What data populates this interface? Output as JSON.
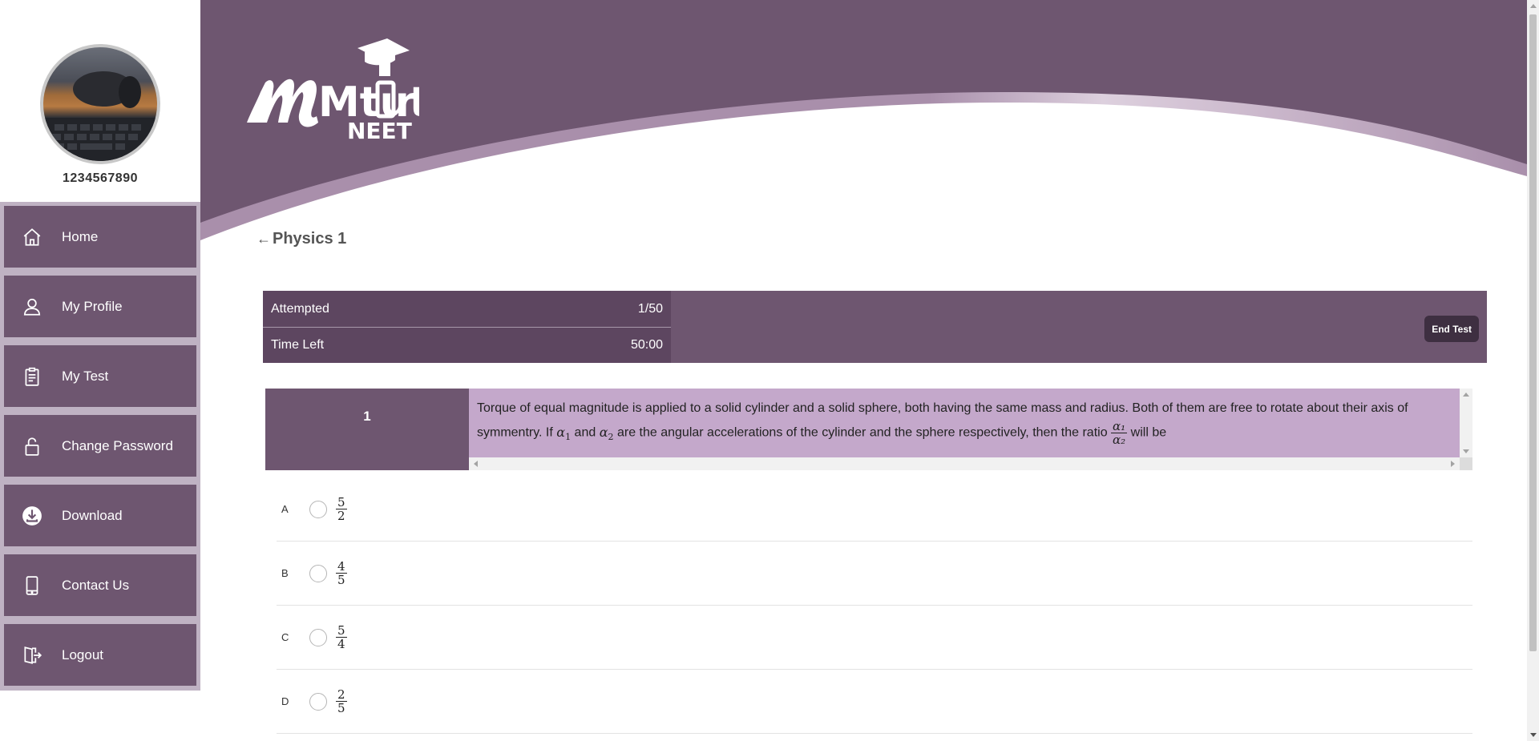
{
  "user": {
    "phone": "1234567890"
  },
  "sidebar": {
    "items": [
      {
        "label": "Home",
        "icon": "home-icon"
      },
      {
        "label": "My Profile",
        "icon": "user-icon"
      },
      {
        "label": "My Test",
        "icon": "clipboard-icon"
      },
      {
        "label": "Change Password",
        "icon": "lock-icon"
      },
      {
        "label": "Download",
        "icon": "download-icon"
      },
      {
        "label": "Contact Us",
        "icon": "mobile-icon"
      },
      {
        "label": "Logout",
        "icon": "logout-icon"
      }
    ]
  },
  "header": {
    "logo_text": "Mtut",
    "logo_text_end": "r",
    "logo_sub": "NEET"
  },
  "page": {
    "title": "Physics 1"
  },
  "status": {
    "attempted_label": "Attempted",
    "attempted_value": "1/50",
    "time_left_label": "Time Left",
    "time_left_value": "50:00",
    "end_test_label": "End Test"
  },
  "question": {
    "number": "1",
    "text_part1": "Torque of equal magnitude is applied to a solid cylinder and a solid sphere, both having the same mass and radius. Both of them are free to rotate about their axis of symmentry. If",
    "sym_a1": "α",
    "sub_1": "1",
    "text_and": "and",
    "sym_a2": "α",
    "sub_2": "2",
    "text_part2": "are the angular accelerations of the cylinder and the sphere respectively, then the ratio",
    "ratio_num": "α₁",
    "ratio_den": "α₂",
    "text_part3": "will be"
  },
  "options": [
    {
      "letter": "A",
      "num": "5",
      "den": "2"
    },
    {
      "letter": "B",
      "num": "4",
      "den": "5"
    },
    {
      "letter": "C",
      "num": "5",
      "den": "4"
    },
    {
      "letter": "D",
      "num": "2",
      "den": "5"
    }
  ],
  "colors": {
    "primary": "#6e5670",
    "dark": "#5d4660",
    "question_bg": "#c4a8cb",
    "sidebar_frame": "#bfb2c3"
  }
}
